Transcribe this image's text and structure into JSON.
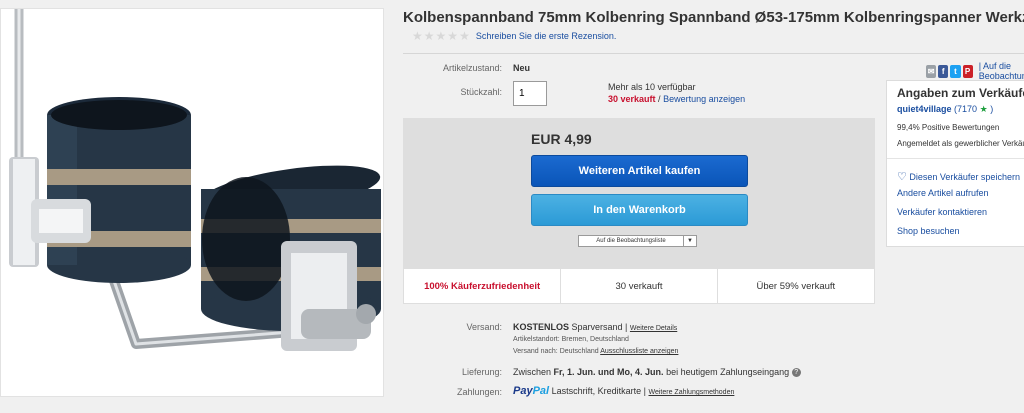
{
  "product": {
    "title": "Kolbenspannband 75mm Kolbenring Spannband Ø53-175mm Kolbenringspanner Werkzeug",
    "review_link": "Schreiben Sie die erste Rezension."
  },
  "condition": {
    "label": "Artikelzustand:",
    "value": "Neu"
  },
  "quantity": {
    "label": "Stückzahl:",
    "value": "1",
    "available": "Mehr als 10 verfügbar",
    "sold": "30 verkauft",
    "separator": "/",
    "reviews_link": "Bewertung anzeigen"
  },
  "buy": {
    "price": "EUR 4,99",
    "buy_now": "Weiteren Artikel kaufen",
    "add_to_cart": "In den Warenkorb",
    "watchlist": "Auf die Beobachtungsliste"
  },
  "stats": {
    "satisfaction": "100% Käuferzufriedenheit",
    "sold": "30 verkauft",
    "over_sold": "Über 59% verkauft"
  },
  "shipping": {
    "label": "Versand:",
    "cost": "KOSTENLOS",
    "method": "Sparversand |",
    "more_details": "Weitere Details",
    "location_label": "Artikelstandort:",
    "location": "Bremen, Deutschland",
    "ships_to_label": "Versand nach:",
    "ships_to": "Deutschland",
    "exclusions": "Ausschlussliste anzeigen"
  },
  "delivery": {
    "label": "Lieferung:",
    "prefix": "Zwischen",
    "dates": "Fr, 1. Jun. und Mo, 4. Jun.",
    "suffix": "bei heutigem Zahlungseingang"
  },
  "payment": {
    "label": "Zahlungen:",
    "paypal_pay": "Pay",
    "paypal_pal": "Pal",
    "methods": "Lastschrift,  Kreditkarte  |",
    "more_methods": "Weitere Zahlungsmethoden"
  },
  "seller": {
    "title": "Angaben zum Verkäufer",
    "name": "quiet4village",
    "score": "(7170",
    "score_close": ")",
    "positive": "99,4% Positive Bewertungen",
    "registered": "Angemeldet als gewerblicher Verkäufer",
    "save_seller": "Diesen Verkäufer speichern",
    "other_items": "Andere Artikel aufrufen",
    "contact": "Verkäufer kontaktieren",
    "shop": "Shop besuchen"
  },
  "share": {
    "more": "| Auf die Beobachtungsliste"
  },
  "colors": {
    "buy_button": "#0a55b8",
    "cart_button": "#2b9ad6",
    "link": "#1a4ea0",
    "alert": "#c8102e",
    "star": "#1e9e3e",
    "facebook": "#3b5998",
    "twitter": "#1da1f2",
    "pinterest": "#cb2027"
  }
}
